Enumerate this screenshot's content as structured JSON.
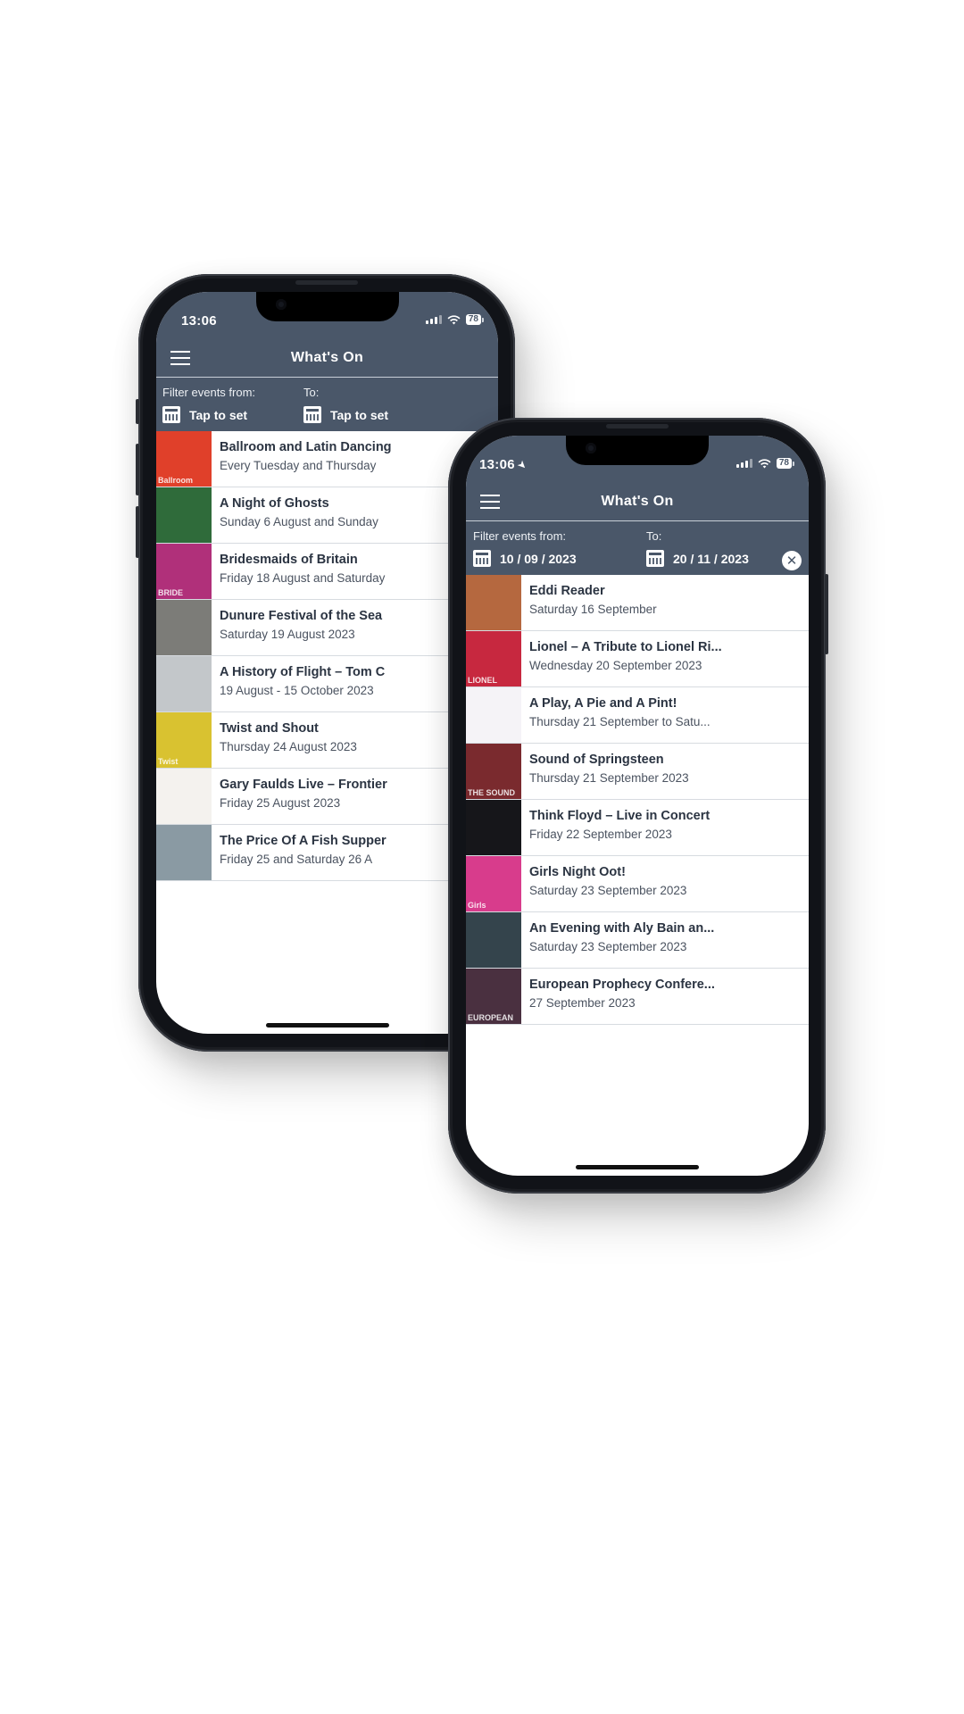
{
  "phones": {
    "left": {
      "status": {
        "time": "13:06",
        "battery": "78"
      },
      "nav": {
        "title": "What's On"
      },
      "filter": {
        "from_label": "Filter events from:",
        "from_value": "Tap to set",
        "to_label": "To:",
        "to_value": "Tap to set"
      },
      "events": [
        {
          "title": "Ballroom and Latin Dancing",
          "date": "Every Tuesday and Thursday",
          "thumb_color": "#e0402a",
          "thumb_text": "Ballroom"
        },
        {
          "title": "A Night of Ghosts",
          "date": "Sunday 6 August and Sunday",
          "thumb_color": "#2f6b3a",
          "thumb_text": ""
        },
        {
          "title": "Bridesmaids of Britain",
          "date": "Friday 18 August and Saturday",
          "thumb_color": "#b0307a",
          "thumb_text": "BRIDE"
        },
        {
          "title": "Dunure Festival of the Sea",
          "date": " Saturday 19 August 2023",
          "thumb_color": "#7c7c78",
          "thumb_text": ""
        },
        {
          "title": "A History of Flight – Tom C",
          "date": "19 August - 15 October 2023",
          "thumb_color": "#c3c7ca",
          "thumb_text": ""
        },
        {
          "title": "Twist and Shout",
          "date": "Thursday 24 August 2023",
          "thumb_color": "#d9c230",
          "thumb_text": "Twist"
        },
        {
          "title": "Gary Faulds Live – Frontier",
          "date": "Friday 25 August 2023",
          "thumb_color": "#f4f2ee",
          "thumb_text": ""
        },
        {
          "title": "The Price Of A Fish Supper",
          "date": "Friday 25 and Saturday 26 A",
          "thumb_color": "#8a9aa3",
          "thumb_text": ""
        }
      ]
    },
    "right": {
      "status": {
        "time": "13:06",
        "battery": "78"
      },
      "nav": {
        "title": "What's On"
      },
      "filter": {
        "from_label": "Filter events from:",
        "from_value": "10 / 09 / 2023",
        "to_label": "To:",
        "to_value": "20 / 11 / 2023",
        "clear_icon": "close-circle"
      },
      "events": [
        {
          "title": "Eddi Reader",
          "date": "Saturday 16 September",
          "thumb_color": "#b5683f",
          "thumb_text": ""
        },
        {
          "title": "Lionel – A Tribute to Lionel Ri...",
          "date": "Wednesday 20 September 2023",
          "thumb_color": "#c7283f",
          "thumb_text": "LIONEL"
        },
        {
          "title": "A Play, A Pie and A Pint!",
          "date": "Thursday 21 September to Satu...",
          "thumb_color": "#f5f3f7",
          "thumb_text": ""
        },
        {
          "title": "Sound of Springsteen",
          "date": "Thursday 21 September 2023",
          "thumb_color": "#7a2a2e",
          "thumb_text": "THE SOUND"
        },
        {
          "title": "Think Floyd – Live in Concert",
          "date": "Friday 22 September 2023",
          "thumb_color": "#16161a",
          "thumb_text": ""
        },
        {
          "title": "Girls Night Oot!",
          "date": "Saturday 23 September 2023",
          "thumb_color": "#d83c8c",
          "thumb_text": "Girls"
        },
        {
          "title": "An Evening with Aly Bain an...",
          "date": "Saturday 23 September 2023",
          "thumb_color": "#34444c",
          "thumb_text": ""
        },
        {
          "title": "European Prophecy Confere...",
          "date": "27 September 2023",
          "thumb_color": "#4a3040",
          "thumb_text": "EUROPEAN"
        }
      ]
    }
  },
  "colors": {
    "header": "#4a5769",
    "title_text": "#2b3442",
    "date_text": "#4b5360",
    "divider": "#d7dbe0"
  }
}
